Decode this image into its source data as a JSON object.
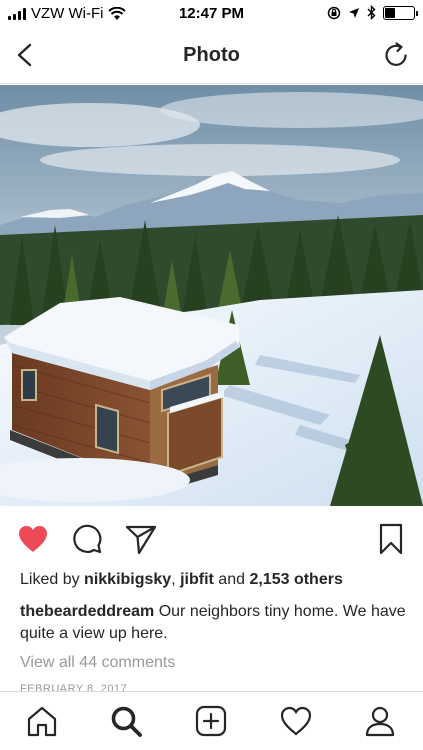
{
  "status_bar": {
    "carrier": "VZW Wi-Fi",
    "time": "12:47 PM",
    "battery_level": 0.35
  },
  "nav": {
    "title": "Photo",
    "back_icon": "chevron-left-icon",
    "refresh_icon": "refresh-icon"
  },
  "photo": {
    "alt": "Tiny house with snow on the roof in a snowy forest with mountains"
  },
  "actions": {
    "like_icon": "heart-filled-icon",
    "like_color": "#ed4956",
    "comment_icon": "comment-icon",
    "share_icon": "paper-plane-icon",
    "save_icon": "bookmark-icon"
  },
  "post": {
    "liked_by_prefix": "Liked by ",
    "liked_user_1": "nikkibigsky",
    "liked_sep": ", ",
    "liked_user_2": "jibfit",
    "liked_and": " and ",
    "liked_others": "2,153 others",
    "caption_user": "thebeardeddream",
    "caption_text": " Our neighbors tiny home. We have quite a view up here.",
    "view_comments": "View all 44 comments",
    "date": "FEBRUARY 8, 2017"
  },
  "tab_bar": {
    "items": [
      "home-icon",
      "search-icon",
      "add-icon",
      "activity-icon",
      "profile-icon"
    ]
  }
}
